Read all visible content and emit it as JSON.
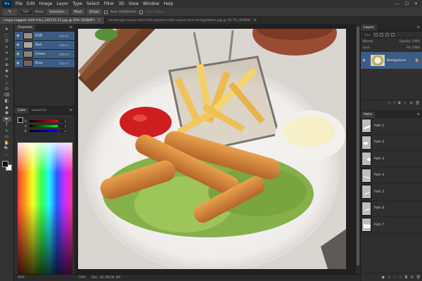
{
  "app": {
    "logo": "Ps"
  },
  "menu": [
    "File",
    "Edit",
    "Image",
    "Layer",
    "Type",
    "Select",
    "Filter",
    "3D",
    "View",
    "Window",
    "Help"
  ],
  "window_controls": [
    "—",
    "☐",
    "✕"
  ],
  "options": {
    "tool_label": "✎",
    "mode_value": "Path",
    "make_label": "Make:",
    "selection_label": "Selection...",
    "mask_label": "Mask",
    "shape_label": "Shape",
    "auto_label": "Auto Add/Delete",
    "align_label": "Align Edges"
  },
  "tabs": [
    {
      "label": "crispy-nuggets-with-fries_140725-12.jpg @ 50% (RGB/8*)",
      "active": true
    },
    {
      "label": "hamburger-sauce-rolls-fried-potatoes-with-sauce-slice-of-vegetables.jpg @ 16.7% (RGB/8)",
      "active": false
    }
  ],
  "tools": [
    "➤",
    "⬚",
    "ʘ",
    "⌖",
    "⌗",
    "✂",
    "⊕",
    "✚",
    "✎",
    "♨",
    "⊙",
    "⌫",
    "◧",
    "▲",
    "◉",
    "✒",
    "T",
    "↖",
    "▭",
    "✋",
    "🔍",
    "⋯"
  ],
  "channels": {
    "tabs": [
      "Channels"
    ],
    "menu_icon": "≡",
    "rows": [
      {
        "name": "RGB",
        "shortcut": "Ctrl+2",
        "thumb": "#9a8c80"
      },
      {
        "name": "Red",
        "shortcut": "Ctrl+3",
        "thumb": "#b0a49a"
      },
      {
        "name": "Green",
        "shortcut": "Ctrl+4",
        "thumb": "#8a8079"
      },
      {
        "name": "Blue",
        "shortcut": "Ctrl+5",
        "thumb": "#6c6560"
      }
    ]
  },
  "color": {
    "tabs": [
      "Color",
      "Swatches"
    ],
    "sliders": [
      {
        "label": "R",
        "value": "0"
      },
      {
        "label": "G",
        "value": "0"
      },
      {
        "label": "B",
        "value": "0"
      }
    ]
  },
  "layers": {
    "tabs": [
      "Layers"
    ],
    "kind_label": "Kind",
    "blend_label": "Normal",
    "opacity_label": "Opacity: 100%",
    "lock_label": "Lock:",
    "fill_label": "Fill: 100%",
    "layer_name": "Background"
  },
  "paths": {
    "tabs": [
      "Paths"
    ],
    "items": [
      "Path 1",
      "Path 2",
      "Path 3",
      "Path 4",
      "Path 5",
      "Path 6",
      "Path 7"
    ]
  },
  "status": {
    "zoom": "50%",
    "doc": "Doc: 34.3M/34.3M"
  },
  "left_status": "50%"
}
